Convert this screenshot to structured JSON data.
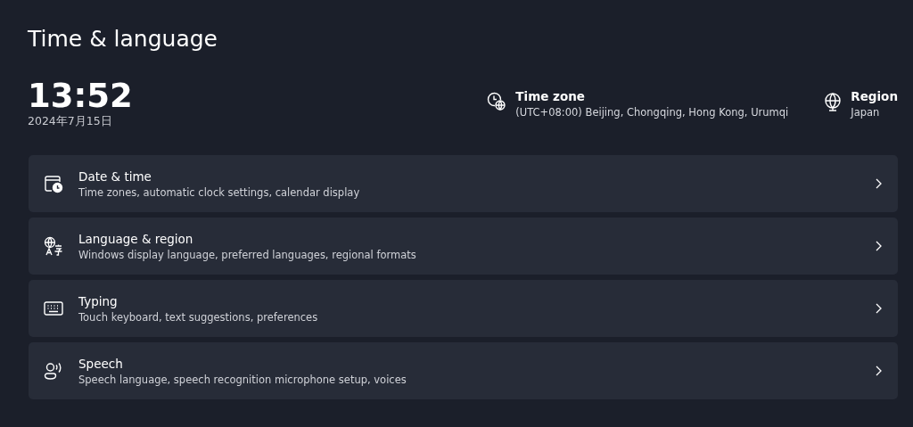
{
  "page_title": "Time & language",
  "clock": {
    "time": "13:52",
    "date": "2024年7月15日"
  },
  "info": [
    {
      "kind": "timezone",
      "label": "Time zone",
      "value": "(UTC+08:00) Beijing, Chongqing, Hong Kong, Urumqi"
    },
    {
      "kind": "region",
      "label": "Region",
      "value": "Japan"
    }
  ],
  "items": [
    {
      "kind": "date-time",
      "title": "Date & time",
      "description": "Time zones, automatic clock settings, calendar display"
    },
    {
      "kind": "language",
      "title": "Language & region",
      "description": "Windows display language, preferred languages, regional formats"
    },
    {
      "kind": "typing",
      "title": "Typing",
      "description": "Touch keyboard, text suggestions, preferences"
    },
    {
      "kind": "speech",
      "title": "Speech",
      "description": "Speech language, speech recognition microphone setup, voices"
    }
  ]
}
